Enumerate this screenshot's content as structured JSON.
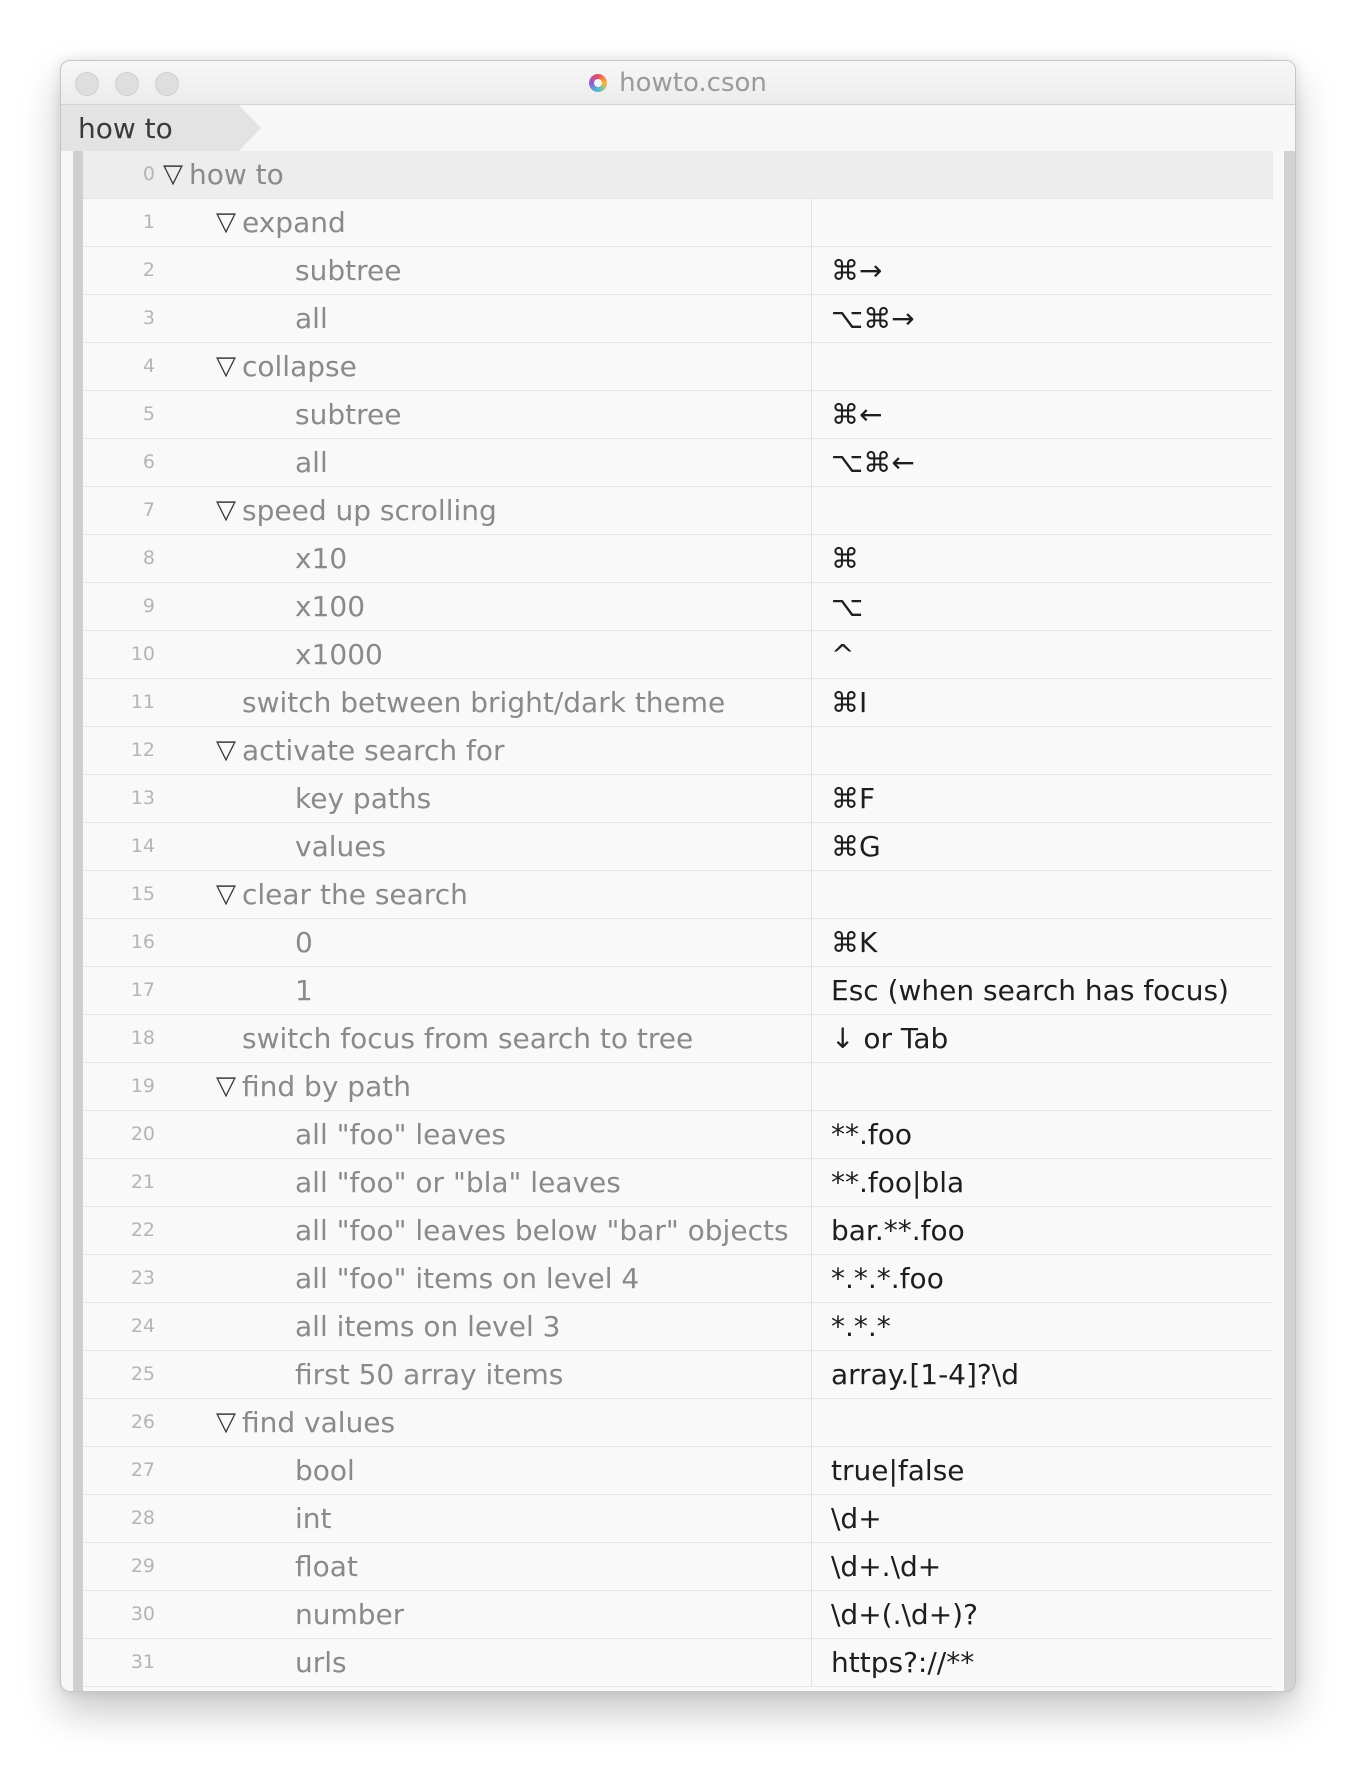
{
  "window": {
    "title": "howto.cson"
  },
  "breadcrumb": {
    "label": "how to"
  },
  "rows": [
    {
      "num": "0",
      "key": "how to",
      "value": "",
      "level": 0,
      "expandable": true
    },
    {
      "num": "1",
      "key": "expand",
      "value": "",
      "level": 1,
      "expandable": true
    },
    {
      "num": "2",
      "key": "subtree",
      "value": "⌘→",
      "level": 2,
      "expandable": false
    },
    {
      "num": "3",
      "key": "all",
      "value": "⌥⌘→",
      "level": 2,
      "expandable": false
    },
    {
      "num": "4",
      "key": "collapse",
      "value": "",
      "level": 1,
      "expandable": true
    },
    {
      "num": "5",
      "key": "subtree",
      "value": "⌘←",
      "level": 2,
      "expandable": false
    },
    {
      "num": "6",
      "key": "all",
      "value": "⌥⌘←",
      "level": 2,
      "expandable": false
    },
    {
      "num": "7",
      "key": "speed up scrolling",
      "value": "",
      "level": 1,
      "expandable": true
    },
    {
      "num": "8",
      "key": "x10",
      "value": "⌘",
      "level": 2,
      "expandable": false
    },
    {
      "num": "9",
      "key": "x100",
      "value": "⌥",
      "level": 2,
      "expandable": false
    },
    {
      "num": "10",
      "key": "x1000",
      "value": "^",
      "level": 2,
      "expandable": false
    },
    {
      "num": "11",
      "key": "switch between bright/dark theme",
      "value": "⌘I",
      "level": 1,
      "expandable": false
    },
    {
      "num": "12",
      "key": "activate search for",
      "value": "",
      "level": 1,
      "expandable": true
    },
    {
      "num": "13",
      "key": "key paths",
      "value": "⌘F",
      "level": 2,
      "expandable": false
    },
    {
      "num": "14",
      "key": "values",
      "value": "⌘G",
      "level": 2,
      "expandable": false
    },
    {
      "num": "15",
      "key": "clear the search",
      "value": "",
      "level": 1,
      "expandable": true
    },
    {
      "num": "16",
      "key": "0",
      "value": "⌘K",
      "level": 2,
      "expandable": false
    },
    {
      "num": "17",
      "key": "1",
      "value": "Esc (when search has focus)",
      "level": 2,
      "expandable": false
    },
    {
      "num": "18",
      "key": "switch focus from search to tree",
      "value": "↓ or Tab",
      "level": 1,
      "expandable": false
    },
    {
      "num": "19",
      "key": "find by path",
      "value": "",
      "level": 1,
      "expandable": true
    },
    {
      "num": "20",
      "key": "all \"foo\" leaves",
      "value": "**.foo",
      "level": 2,
      "expandable": false
    },
    {
      "num": "21",
      "key": "all \"foo\" or \"bla\" leaves",
      "value": "**.foo|bla",
      "level": 2,
      "expandable": false
    },
    {
      "num": "22",
      "key": "all \"foo\" leaves below \"bar\" objects",
      "value": "bar.**.foo",
      "level": 2,
      "expandable": false
    },
    {
      "num": "23",
      "key": "all \"foo\" items on level 4",
      "value": "*.*.*.foo",
      "level": 2,
      "expandable": false
    },
    {
      "num": "24",
      "key": "all items on level 3",
      "value": "*.*.*",
      "level": 2,
      "expandable": false
    },
    {
      "num": "25",
      "key": "first 50 array items",
      "value": "array.[1-4]?\\d",
      "level": 2,
      "expandable": false
    },
    {
      "num": "26",
      "key": "find values",
      "value": "",
      "level": 1,
      "expandable": true
    },
    {
      "num": "27",
      "key": "bool",
      "value": "true|false",
      "level": 2,
      "expandable": false
    },
    {
      "num": "28",
      "key": "int",
      "value": "\\d+",
      "level": 2,
      "expandable": false
    },
    {
      "num": "29",
      "key": "float",
      "value": "\\d+.\\d+",
      "level": 2,
      "expandable": false
    },
    {
      "num": "30",
      "key": "number",
      "value": "\\d+(.\\d+)?",
      "level": 2,
      "expandable": false
    },
    {
      "num": "31",
      "key": "urls",
      "value": "https?://**",
      "level": 2,
      "expandable": false
    }
  ]
}
